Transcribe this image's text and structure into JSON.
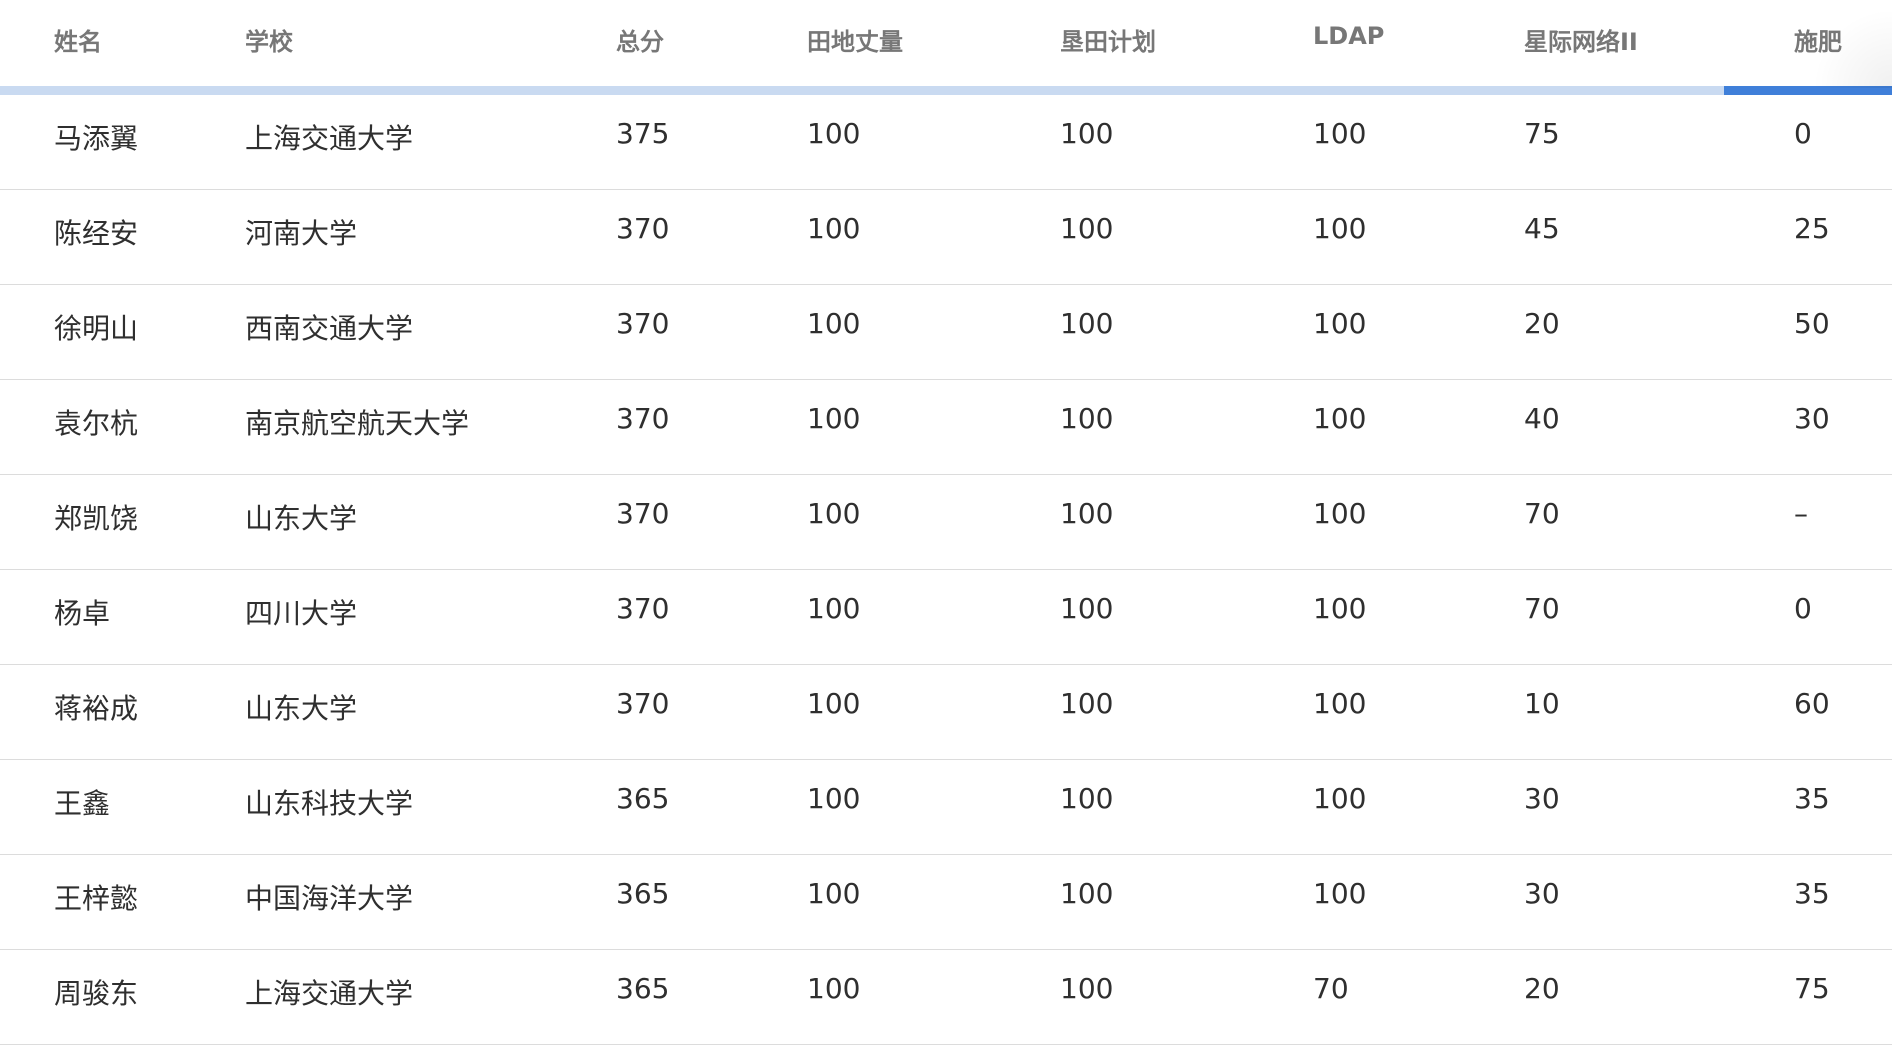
{
  "table": {
    "columns": [
      "姓名",
      "学校",
      "总分",
      "田地丈量",
      "垦田计划",
      "LDAP",
      "星际网络II",
      "施肥"
    ],
    "rows": [
      [
        "马添翼",
        "上海交通大学",
        "375",
        "100",
        "100",
        "100",
        "75",
        "0"
      ],
      [
        "陈经安",
        "河南大学",
        "370",
        "100",
        "100",
        "100",
        "45",
        "25"
      ],
      [
        "徐明山",
        "西南交通大学",
        "370",
        "100",
        "100",
        "100",
        "20",
        "50"
      ],
      [
        "袁尔杭",
        "南京航空航天大学",
        "370",
        "100",
        "100",
        "100",
        "40",
        "30"
      ],
      [
        "郑凯饶",
        "山东大学",
        "370",
        "100",
        "100",
        "100",
        "70",
        "–"
      ],
      [
        "杨卓",
        "四川大学",
        "370",
        "100",
        "100",
        "100",
        "70",
        "0"
      ],
      [
        "蒋裕成",
        "山东大学",
        "370",
        "100",
        "100",
        "100",
        "10",
        "60"
      ],
      [
        "王鑫",
        "山东科技大学",
        "365",
        "100",
        "100",
        "100",
        "30",
        "35"
      ],
      [
        "王梓懿",
        "中国海洋大学",
        "365",
        "100",
        "100",
        "100",
        "30",
        "35"
      ],
      [
        "周骏东",
        "上海交通大学",
        "365",
        "100",
        "100",
        "70",
        "20",
        "75"
      ]
    ]
  },
  "colors": {
    "scrollbar_track": "#c9daf1",
    "scrollbar_thumb": "#3f7fd9",
    "header_text": "#777777",
    "row_divider": "#dcdcdc"
  }
}
